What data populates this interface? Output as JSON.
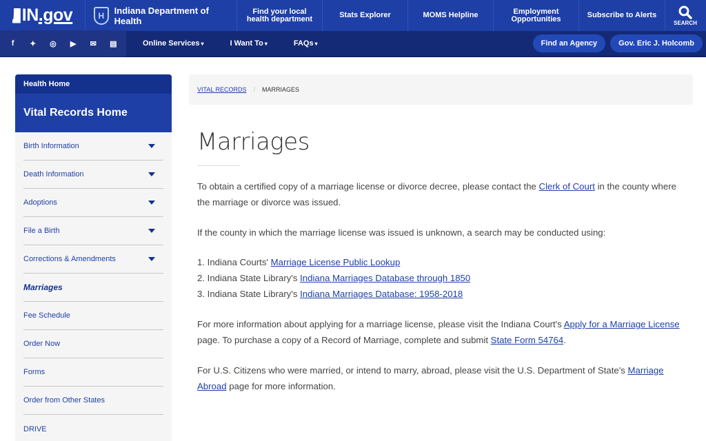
{
  "header": {
    "brand_prefix": "IN",
    "brand_suffix": ".gov",
    "agency_logo_text": "H",
    "agency_name": "Indiana Department of Health",
    "nav": [
      {
        "label": "Find your local health department"
      },
      {
        "label": "Stats Explorer"
      },
      {
        "label": "MOMS Helpline"
      },
      {
        "label": "Employment Opportunities"
      },
      {
        "label": "Subscribe to Alerts"
      }
    ],
    "search_label": "SEARCH"
  },
  "subnav": {
    "social": [
      {
        "icon": "facebook-icon",
        "glyph": "f"
      },
      {
        "icon": "twitter-icon",
        "glyph": "✦"
      },
      {
        "icon": "instagram-icon",
        "glyph": "◎"
      },
      {
        "icon": "youtube-icon",
        "glyph": "▶"
      },
      {
        "icon": "email-icon",
        "glyph": "✉"
      },
      {
        "icon": "calendar-icon",
        "glyph": "▤"
      }
    ],
    "menus": [
      {
        "label": "Online Services",
        "caret": "▾"
      },
      {
        "label": "I Want To",
        "caret": "▾"
      },
      {
        "label": "FAQs",
        "caret": "▾"
      }
    ],
    "pills": [
      {
        "label": "Find an Agency"
      },
      {
        "label": "Gov. Eric J. Holcomb"
      }
    ]
  },
  "sidebar": {
    "head": "Health Home",
    "title": "Vital Records Home",
    "items": [
      {
        "label": "Birth Information",
        "expandable": true
      },
      {
        "label": "Death Information",
        "expandable": true
      },
      {
        "label": "Adoptions",
        "expandable": true
      },
      {
        "label": "File a Birth",
        "expandable": true
      },
      {
        "label": "Corrections & Amendments",
        "expandable": true
      },
      {
        "label": "Marriages",
        "expandable": false,
        "active": true
      },
      {
        "label": "Fee Schedule",
        "expandable": false
      },
      {
        "label": "Order Now",
        "expandable": false
      },
      {
        "label": "Forms",
        "expandable": false
      },
      {
        "label": "Order from Other States",
        "expandable": false
      },
      {
        "label": "DRIVE",
        "expandable": false
      }
    ]
  },
  "breadcrumb": {
    "parent": "VITAL RECORDS",
    "separator": "/",
    "current": "MARRIAGES"
  },
  "main": {
    "title": "Marriages",
    "p1": {
      "before": "To obtain a certified copy of a marriage license or divorce decree, please contact the ",
      "link": "Clerk of Court",
      "after": " in the county where the marriage or divorce was issued."
    },
    "p2": "If the county in which the marriage license was issued is unknown, a search may be conducted using:",
    "list": [
      {
        "prefix": "1. Indiana Courts' ",
        "link": "Marriage License Public Lookup"
      },
      {
        "prefix": "2. Indiana State Library's ",
        "link": "Indiana Marriages Database through 1850"
      },
      {
        "prefix": "3. Indiana State Library's ",
        "link": "Indiana Marriages Database: 1958-2018"
      }
    ],
    "p3": {
      "before": "For more information about applying for a marriage license, please visit the Indiana Court's ",
      "link1": "Apply for a Marriage License",
      "middle": " page. To purchase a copy of a Record of Marriage, complete and submit ",
      "link2": "State Form 54764",
      "after": "."
    },
    "p4": {
      "before": "For U.S. Citizens who were married, or intend to marry, abroad, please visit the U.S. Department of State's ",
      "link": "Marriage Abroad",
      "after": " page for more information."
    }
  }
}
